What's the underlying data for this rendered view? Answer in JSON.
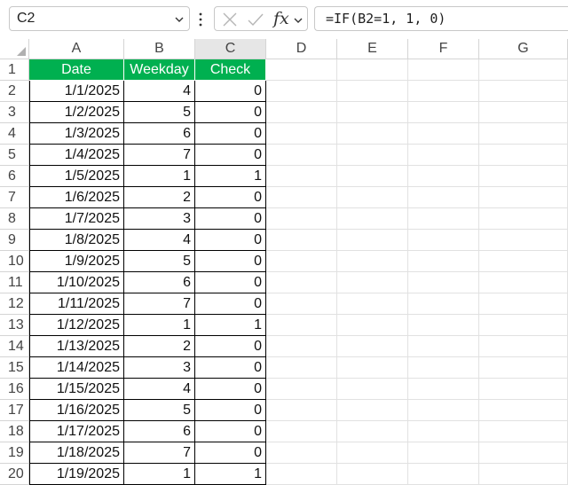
{
  "formula_bar": {
    "name_box": "C2",
    "formula": "=IF(B2=1, 1, 0)",
    "fx_label": "fx"
  },
  "columns": [
    "A",
    "B",
    "C",
    "D",
    "E",
    "F",
    "G"
  ],
  "selected_column": "C",
  "table": {
    "headers": [
      "Date",
      "Weekday",
      "Check"
    ],
    "header_color": "#00b050",
    "rows": [
      [
        "1/1/2025",
        "4",
        "0"
      ],
      [
        "1/2/2025",
        "5",
        "0"
      ],
      [
        "1/3/2025",
        "6",
        "0"
      ],
      [
        "1/4/2025",
        "7",
        "0"
      ],
      [
        "1/5/2025",
        "1",
        "1"
      ],
      [
        "1/6/2025",
        "2",
        "0"
      ],
      [
        "1/7/2025",
        "3",
        "0"
      ],
      [
        "1/8/2025",
        "4",
        "0"
      ],
      [
        "1/9/2025",
        "5",
        "0"
      ],
      [
        "1/10/2025",
        "6",
        "0"
      ],
      [
        "1/11/2025",
        "7",
        "0"
      ],
      [
        "1/12/2025",
        "1",
        "1"
      ],
      [
        "1/13/2025",
        "2",
        "0"
      ],
      [
        "1/14/2025",
        "3",
        "0"
      ],
      [
        "1/15/2025",
        "4",
        "0"
      ],
      [
        "1/16/2025",
        "5",
        "0"
      ],
      [
        "1/17/2025",
        "6",
        "0"
      ],
      [
        "1/18/2025",
        "7",
        "0"
      ],
      [
        "1/19/2025",
        "1",
        "1"
      ]
    ]
  },
  "row_numbers": [
    "1",
    "2",
    "3",
    "4",
    "5",
    "6",
    "7",
    "8",
    "9",
    "10",
    "11",
    "12",
    "13",
    "14",
    "15",
    "16",
    "17",
    "18",
    "19",
    "20"
  ]
}
